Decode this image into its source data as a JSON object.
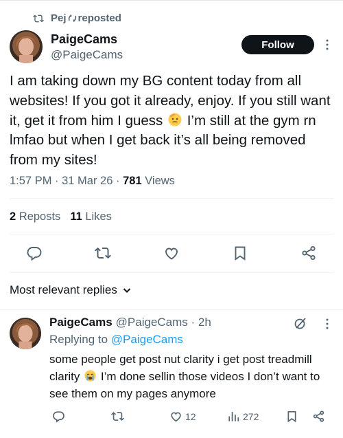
{
  "repost_banner": {
    "name_part1": "Pej",
    "name_part2": "reposted"
  },
  "tweet": {
    "author_name": "PaigeCams",
    "author_handle": "@PaigeCams",
    "follow_label": "Follow",
    "text_before_emoji": "I am taking down my BG content today from all websites! If you got it already, enjoy. If you still want it, get it from him I guess",
    "text_after_emoji": "I’m still at the gym rn lmfao but when I get back it’s all being removed from my sites!",
    "time": "1:57 PM",
    "date": "31 Mar 26",
    "views_count": "781",
    "views_label": "Views",
    "reposts_count": "2",
    "reposts_label": "Reposts",
    "likes_count": "11",
    "likes_label": "Likes"
  },
  "replies_sort_label": "Most relevant replies",
  "reply": {
    "author_name": "PaigeCams",
    "author_handle": "@PaigeCams",
    "age": "2h",
    "replying_prefix": "Replying to",
    "replying_handle": "@PaigeCams",
    "text_before_emoji": "some people get post nut clarity i get post treadmill clarity",
    "text_after_emoji": "I’m done sellin those videos I don’t want to see them on my pages anymore",
    "likes_count": "12",
    "views_count": "272"
  },
  "icons": [
    "repost-icon",
    "more-icon",
    "reply-icon",
    "like-icon",
    "bookmark-icon",
    "share-icon",
    "chevron-down-icon",
    "grok-icon",
    "views-icon",
    "saluting-face-emoji",
    "crying-face-emoji"
  ],
  "colors": {
    "accent": "#1d9bf0",
    "muted": "#536471",
    "text": "#0f1419",
    "button_bg": "#0f1419"
  }
}
